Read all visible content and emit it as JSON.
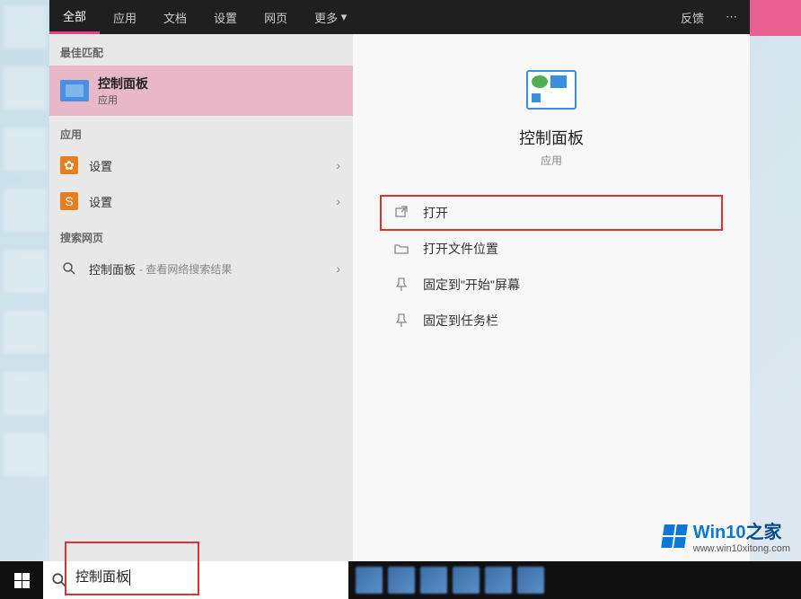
{
  "tabs": {
    "all": "全部",
    "apps": "应用",
    "docs": "文档",
    "settings": "设置",
    "web": "网页",
    "more": "更多",
    "feedback": "反馈"
  },
  "sections": {
    "best_match": "最佳匹配",
    "apps": "应用",
    "web": "搜索网页"
  },
  "best": {
    "title": "控制面板",
    "sub": "应用"
  },
  "appsList": [
    {
      "label": "设置"
    },
    {
      "label": "设置"
    }
  ],
  "webSearch": {
    "label": "控制面板",
    "hint": "- 查看网络搜索结果"
  },
  "detail": {
    "title": "控制面板",
    "sub": "应用"
  },
  "actions": {
    "open": "打开",
    "open_location": "打开文件位置",
    "pin_start": "固定到\"开始\"屏幕",
    "pin_taskbar": "固定到任务栏"
  },
  "search": {
    "value": "控制面板"
  },
  "watermark": {
    "brand_prefix": "Win10",
    "brand_suffix": "之家",
    "url": "www.win10xitong.com"
  }
}
